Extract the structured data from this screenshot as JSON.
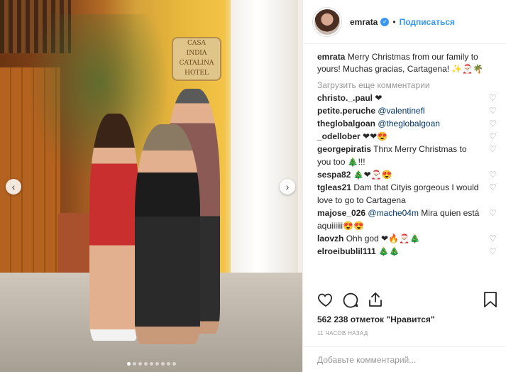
{
  "post": {
    "username": "emrata",
    "separator": "•",
    "follow_label": "Подписаться",
    "caption": "Merry Christmas from our family to yours! Muchas gracias, Cartagena! ✨🎅🏻🌴",
    "load_more": "Загрузить еще комментарии",
    "comments": [
      {
        "user": "christo._.paul",
        "text": "❤"
      },
      {
        "user": "petite.peruche",
        "mention": "@valentinefl",
        "text": ""
      },
      {
        "user": "theglobalgoan",
        "mention": "@theglobalgoan",
        "text": ""
      },
      {
        "user": "_odellober",
        "text": "❤❤😍"
      },
      {
        "user": "georgepiratis",
        "text": "Thnx Merry Christmas to you too 🎄!!!"
      },
      {
        "user": "sespa82",
        "text": "🎄❤🎅🏻😍"
      },
      {
        "user": "tgleas21",
        "text": "Dam that Cityis gorgeous I would love to go to Cartagena"
      },
      {
        "user": "majose_026",
        "mention": "@mache04m",
        "text": "Mira quien está aquiiiiii😍😍"
      },
      {
        "user": "laovzh",
        "text": "Ohh god ❤🔥🎅🏻🎄"
      },
      {
        "user": "elroeibublil111",
        "text": "🎄🎄"
      }
    ],
    "likes": "562 238 отметок \"Нравится\"",
    "time": "11 ЧАСОВ НАЗАД",
    "add_comment_placeholder": "Добавьте комментарий..."
  },
  "photo": {
    "sign_lines": [
      "CASA",
      "INDIA",
      "CATALINA",
      "HOTEL"
    ],
    "carousel_total": 9,
    "carousel_active": 1
  },
  "icons": {
    "verified": "verified-badge-icon",
    "like": "heart-outline-icon",
    "comment": "speech-bubble-icon",
    "share": "share-upload-icon",
    "save": "bookmark-icon",
    "comment_like": "small-heart-icon",
    "prev": "chevron-left-icon",
    "next": "chevron-right-icon"
  },
  "colors": {
    "link": "#3897f0",
    "mention": "#003569",
    "muted": "#999999"
  }
}
